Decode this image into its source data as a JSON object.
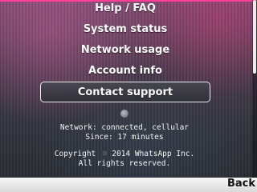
{
  "menu": {
    "items": [
      {
        "label": "Help / FAQ"
      },
      {
        "label": "System status"
      },
      {
        "label": "Network usage"
      },
      {
        "label": "Account info"
      },
      {
        "label": "Contact support",
        "selected": true
      }
    ]
  },
  "status": {
    "network": "Network: connected, cellular",
    "since": "Since: 17 minutes"
  },
  "footer": {
    "copyright_prefix": "Copyright",
    "copyright_suffix": "2014 WhatsApp Inc.",
    "rights": "All rights reserved."
  },
  "softkeys": {
    "right": "Back"
  },
  "colors": {
    "accent": "#ff3f9a",
    "selection_border": "#e9e9ee",
    "softkey_bar": "#e8e8e8"
  },
  "icons": {
    "separator": "dot-icon",
    "copyright_mark": "whatsapp-logo-icon"
  }
}
